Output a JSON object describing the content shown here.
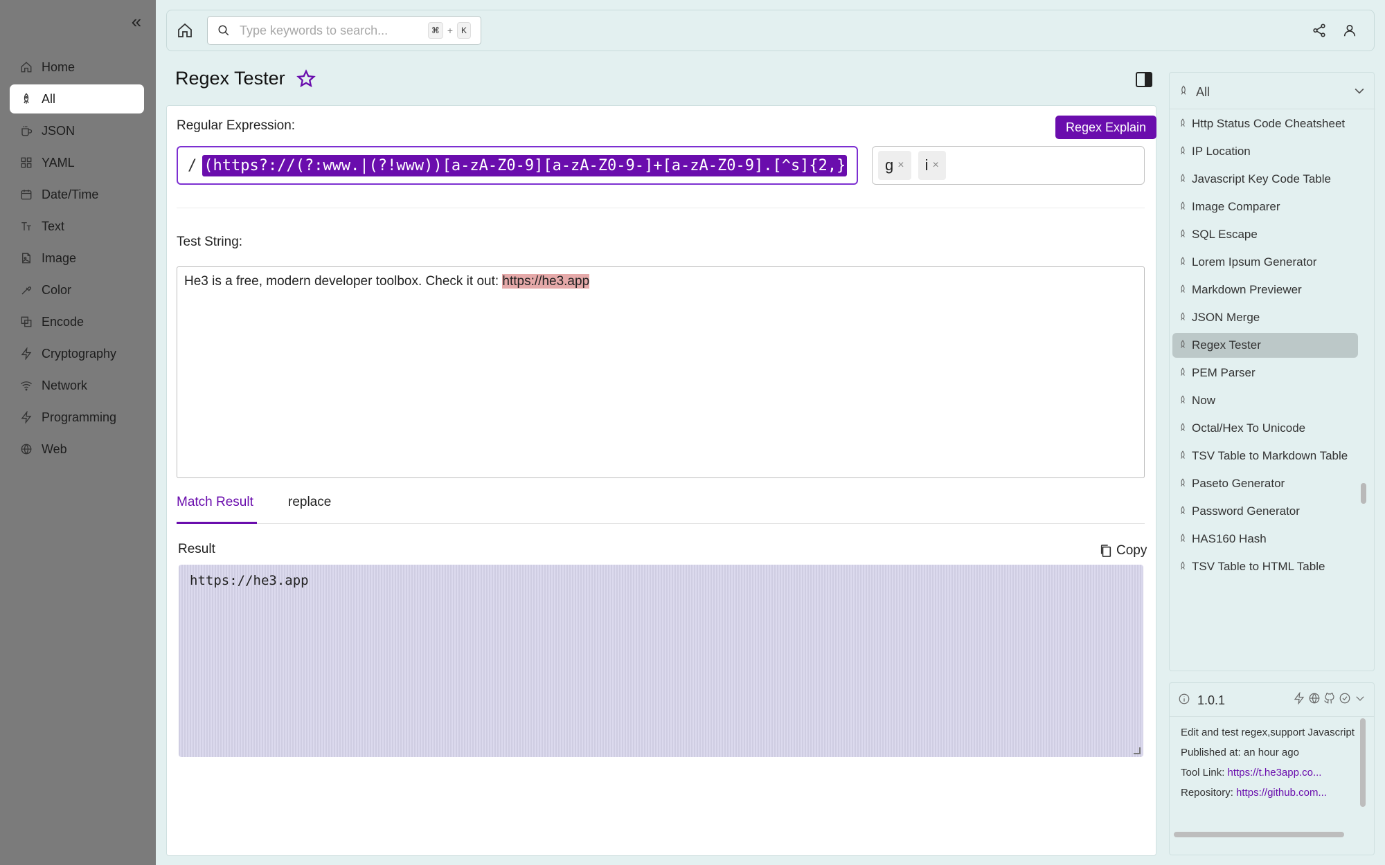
{
  "sidebar": {
    "items": [
      {
        "label": "Home",
        "icon": "home-icon"
      },
      {
        "label": "All",
        "icon": "rocket-icon"
      },
      {
        "label": "JSON",
        "icon": "mug-icon"
      },
      {
        "label": "YAML",
        "icon": "grid-icon"
      },
      {
        "label": "Date/Time",
        "icon": "calendar-icon"
      },
      {
        "label": "Text",
        "icon": "text-icon"
      },
      {
        "label": "Image",
        "icon": "image-icon"
      },
      {
        "label": "Color",
        "icon": "palette-icon"
      },
      {
        "label": "Encode",
        "icon": "encode-icon"
      },
      {
        "label": "Cryptography",
        "icon": "bolt-icon"
      },
      {
        "label": "Network",
        "icon": "wifi-icon"
      },
      {
        "label": "Programming",
        "icon": "bolt-icon"
      },
      {
        "label": "Web",
        "icon": "globe-icon"
      }
    ],
    "active_index": 1
  },
  "topbar": {
    "search_placeholder": "Type keywords to search...",
    "shortcut_key1": "⌘",
    "shortcut_plus": "+",
    "shortcut_key2": "K"
  },
  "page": {
    "title": "Regex Tester"
  },
  "regex": {
    "label": "Regular Expression:",
    "explain_button": "Regex Explain",
    "slash": "/",
    "expression": "(https?://(?:www.|(?!www))[a-zA-Z0-9][a-zA-Z0-9-]+[a-zA-Z0-9].[^s]{2,}",
    "flags": [
      "g",
      "i"
    ],
    "flag_remove": "×"
  },
  "test": {
    "label": "Test String:",
    "text_before": "He3 is a free, modern developer toolbox. Check it out: ",
    "text_match": "https://he3.app"
  },
  "tabs": {
    "match_result": "Match Result",
    "replace": "replace"
  },
  "result": {
    "label": "Result",
    "copy": "Copy",
    "value": "https://he3.app"
  },
  "tool_list": {
    "category": "All",
    "items": [
      "Http Status Code Cheatsheet",
      "IP Location",
      "Javascript Key Code Table",
      "Image Comparer",
      "SQL Escape",
      "Lorem Ipsum Generator",
      "Markdown Previewer",
      "JSON Merge",
      "Regex Tester",
      "PEM Parser",
      "Now",
      "Octal/Hex To Unicode",
      "TSV Table to Markdown Table",
      "Paseto Generator",
      "Password Generator",
      "HAS160 Hash",
      "TSV Table to HTML Table"
    ],
    "active_index": 8
  },
  "info": {
    "version": "1.0.1",
    "description": "Edit and test regex,support Javascript",
    "published": "Published at: an hour ago",
    "tool_link_label": "Tool Link:",
    "tool_link": "https://t.he3app.co...",
    "repo_label": "Repository:",
    "repo_link": "https://github.com..."
  },
  "colors": {
    "accent": "#6a0dad",
    "sidebar_bg": "#7b7b7b",
    "main_bg": "#e3f0f0",
    "match_highlight": "#e5a9a9"
  }
}
